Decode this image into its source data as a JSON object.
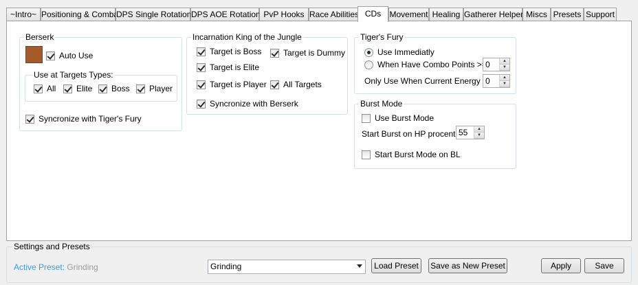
{
  "tabs": [
    {
      "label": "~Intro~"
    },
    {
      "label": "Positioning & Combat"
    },
    {
      "label": "DPS Single Rotation"
    },
    {
      "label": "DPS AOE Rotation"
    },
    {
      "label": "PvP Hooks"
    },
    {
      "label": "Race Abilities"
    },
    {
      "label": "CDs"
    },
    {
      "label": "Movement"
    },
    {
      "label": "Healing"
    },
    {
      "label": "Gatherer Helper"
    },
    {
      "label": "Miscs"
    },
    {
      "label": "Presets"
    },
    {
      "label": "Support"
    }
  ],
  "active_tab": "CDs",
  "berserk": {
    "title": "Berserk",
    "auto_use_label": "Auto Use",
    "auto_use_checked": true,
    "swatch_color": "#a55a2a",
    "target_types": {
      "title": "Use at Targets Types:",
      "all": "All",
      "elite": "Elite",
      "boss": "Boss",
      "player": "Player"
    },
    "sync_label": "Syncronize with Tiger's Fury"
  },
  "incarnation": {
    "title": "Incarnation King of the Jungle",
    "target_boss": "Target is Boss",
    "target_dummy": "Target is Dummy",
    "target_elite": "Target is Elite",
    "target_player": "Target is Player",
    "all_targets": "All Targets",
    "sync_label": "Syncronize with Berserk"
  },
  "tigers_fury": {
    "title": "Tiger's Fury",
    "use_immediately": "Use Immediatly",
    "combo_points_label": "When Have Combo Points  >=",
    "combo_points_value": "0",
    "energy_label": "Only Use When Current  Energy <=",
    "energy_value": "0"
  },
  "burst_mode": {
    "title": "Burst Mode",
    "use_label": "Use Burst Mode",
    "hp_label": "Start Burst on HP procent",
    "hp_value": "55",
    "bl_label": "Start Burst Mode on BL"
  },
  "settings": {
    "title": "Settings and Presets",
    "active_preset_label": "Active Preset:",
    "active_preset_value": "Grinding",
    "preset_select": "Grinding",
    "load_preset": "Load Preset",
    "save_new_preset": "Save as New Preset",
    "apply": "Apply",
    "save": "Save"
  }
}
